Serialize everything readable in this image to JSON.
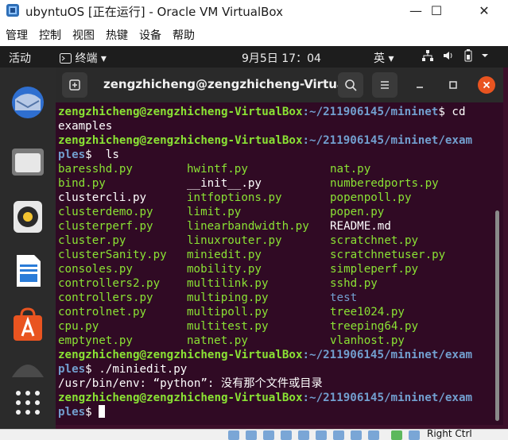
{
  "host_window": {
    "title": "ubyntuOS [正在运行] - Oracle VM VirtualBox",
    "minimize_glyph": "—",
    "maximize_glyph": "☐",
    "close_glyph": "✕"
  },
  "host_menu": [
    "管理",
    "控制",
    "视图",
    "热键",
    "设备",
    "帮助"
  ],
  "gnome_bar": {
    "activities": "活动",
    "app_name": "终端",
    "dropdown_glyph": "▾",
    "clock": "9月5日 17：04",
    "input_method": "英"
  },
  "terminal": {
    "title": "zengzhicheng@zengzhicheng-Virtua...",
    "prompt_user": "zengzhicheng@zengzhicheng-VirtualBox",
    "lines": [
      {
        "path": ":~/211906145/mininet",
        "cmd": "$ cd"
      },
      {
        "text": "examples"
      },
      {
        "path": ":~/211906145/mininet/exam",
        "cmd": ""
      },
      {
        "path2": "ples",
        "cmd": "$  ls"
      }
    ],
    "files": [
      [
        {
          "n": "baresshd.py",
          "c": "g"
        },
        {
          "n": "hwintf.py",
          "c": "g"
        },
        {
          "n": "nat.py",
          "c": "g"
        }
      ],
      [
        {
          "n": "bind.py",
          "c": "g"
        },
        {
          "n": "__init__.py",
          "c": "w"
        },
        {
          "n": "numberedports.py",
          "c": "g"
        }
      ],
      [
        {
          "n": "clustercli.py",
          "c": "w"
        },
        {
          "n": "intfoptions.py",
          "c": "g"
        },
        {
          "n": "popenpoll.py",
          "c": "g"
        }
      ],
      [
        {
          "n": "clusterdemo.py",
          "c": "g"
        },
        {
          "n": "limit.py",
          "c": "g"
        },
        {
          "n": "popen.py",
          "c": "g"
        }
      ],
      [
        {
          "n": "clusterperf.py",
          "c": "g"
        },
        {
          "n": "linearbandwidth.py",
          "c": "g"
        },
        {
          "n": "README.md",
          "c": "w"
        }
      ],
      [
        {
          "n": "cluster.py",
          "c": "g"
        },
        {
          "n": "linuxrouter.py",
          "c": "g"
        },
        {
          "n": "scratchnet.py",
          "c": "g"
        }
      ],
      [
        {
          "n": "clusterSanity.py",
          "c": "g"
        },
        {
          "n": "miniedit.py",
          "c": "g"
        },
        {
          "n": "scratchnetuser.py",
          "c": "g"
        }
      ],
      [
        {
          "n": "consoles.py",
          "c": "g"
        },
        {
          "n": "mobility.py",
          "c": "g"
        },
        {
          "n": "simpleperf.py",
          "c": "g"
        }
      ],
      [
        {
          "n": "controllers2.py",
          "c": "g"
        },
        {
          "n": "multilink.py",
          "c": "g"
        },
        {
          "n": "sshd.py",
          "c": "g"
        }
      ],
      [
        {
          "n": "controllers.py",
          "c": "g"
        },
        {
          "n": "multiping.py",
          "c": "g"
        },
        {
          "n": "test",
          "c": "b"
        }
      ],
      [
        {
          "n": "controlnet.py",
          "c": "g"
        },
        {
          "n": "multipoll.py",
          "c": "g"
        },
        {
          "n": "tree1024.py",
          "c": "g"
        }
      ],
      [
        {
          "n": "cpu.py",
          "c": "g"
        },
        {
          "n": "multitest.py",
          "c": "g"
        },
        {
          "n": "treeping64.py",
          "c": "g"
        }
      ],
      [
        {
          "n": "emptynet.py",
          "c": "g"
        },
        {
          "n": "natnet.py",
          "c": "g"
        },
        {
          "n": "vlanhost.py",
          "c": "g"
        }
      ]
    ],
    "after": [
      {
        "path": ":~/211906145/mininet/exam"
      },
      {
        "path2": "ples",
        "cmd": "$ ./miniedit.py"
      },
      {
        "text": "/usr/bin/env: “python”: 没有那个文件或目录"
      },
      {
        "path": ":~/211906145/mininet/exam"
      },
      {
        "path2": "ples",
        "cmd": "$ "
      }
    ]
  },
  "status_bar": {
    "host_key": "Right Ctrl"
  },
  "colors": {
    "terminal_bg": "#300a24",
    "prompt_green": "#8ae234",
    "path_blue": "#729fcf",
    "close_button": "#e95420",
    "dock_bg": "#2b2b2b",
    "topbar_bg": "#1d1d1d"
  },
  "icons": {
    "host_app": "virtualbox-icon",
    "terminal_new_tab": "new-tab-icon",
    "terminal_search": "search-icon",
    "terminal_menu": "hamburger-menu-icon",
    "dock": [
      "thunderbird-icon",
      "files-icon",
      "rhythmbox-icon",
      "libreoffice-writer-icon",
      "software-center-icon",
      "show-apps-icon"
    ],
    "tray": [
      "network-icon",
      "volume-icon",
      "battery-icon",
      "power-menu-icon"
    ]
  }
}
